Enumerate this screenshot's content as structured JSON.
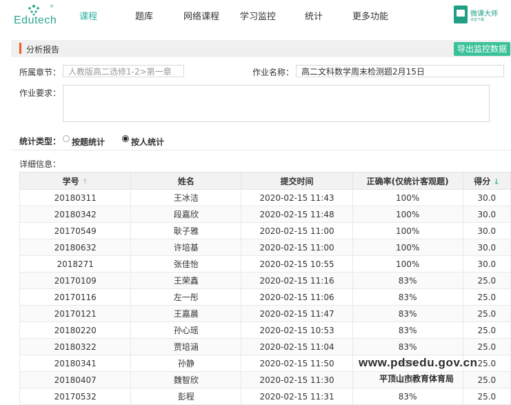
{
  "logo": {
    "text": "Edutech",
    "reg": "®"
  },
  "nav": {
    "items": [
      {
        "label": "课程",
        "active": true
      },
      {
        "label": "题库",
        "active": false
      },
      {
        "label": "网络课程",
        "active": false
      },
      {
        "label": "学习监控",
        "active": false
      },
      {
        "label": "统计",
        "active": false
      },
      {
        "label": "更多功能",
        "active": false
      }
    ]
  },
  "weike": {
    "title": "微课大师",
    "subtitle": "点击下载"
  },
  "section": {
    "title": "分析报告",
    "export_label": "导出监控数据"
  },
  "form": {
    "chapter_label": "所属章节：",
    "chapter_placeholder": "人教版高二选修1-2>第一章",
    "homework_name_label": "作业名称：",
    "homework_name_value": "高二文科数学周末检测题2月15日",
    "requirement_label": "作业要求：",
    "requirement_value": ""
  },
  "stat_type": {
    "label": "统计类型：",
    "options": [
      {
        "label": "按题统计",
        "selected": false
      },
      {
        "label": "按人统计",
        "selected": true
      }
    ]
  },
  "detail_label": "详细信息：",
  "table": {
    "columns": [
      {
        "label": "学号",
        "sort": "↑"
      },
      {
        "label": "姓名",
        "sort": ""
      },
      {
        "label": "提交时间",
        "sort": ""
      },
      {
        "label": "正确率(仅统计客观题)",
        "sort": ""
      },
      {
        "label": "得分",
        "sort": "↓"
      }
    ],
    "rows": [
      [
        "20180311",
        "王冰洁",
        "2020-02-15 11:43",
        "100%",
        "30.0"
      ],
      [
        "20180342",
        "段嘉欣",
        "2020-02-15 11:48",
        "100%",
        "30.0"
      ],
      [
        "20170549",
        "耿子雅",
        "2020-02-15 11:00",
        "100%",
        "30.0"
      ],
      [
        "20180632",
        "许培基",
        "2020-02-15 11:00",
        "100%",
        "30.0"
      ],
      [
        "2018271",
        "张佳怡",
        "2020-02-15 10:55",
        "100%",
        "30.0"
      ],
      [
        "20170109",
        "王荣鑫",
        "2020-02-15 11:16",
        "83%",
        "25.0"
      ],
      [
        "20170116",
        "左一彤",
        "2020-02-15 11:06",
        "83%",
        "25.0"
      ],
      [
        "20170121",
        "王嘉晨",
        "2020-02-15 11:47",
        "83%",
        "25.0"
      ],
      [
        "20180220",
        "孙心瑶",
        "2020-02-15 10:53",
        "83%",
        "25.0"
      ],
      [
        "20180322",
        "贾培涵",
        "2020-02-15 11:04",
        "83%",
        "25.0"
      ],
      [
        "20180341",
        "孙静",
        "2020-02-15 11:50",
        "83%",
        "25.0"
      ],
      [
        "20180407",
        "魏智欣",
        "2020-02-15 11:30",
        "83%",
        "25.0"
      ],
      [
        "20170532",
        "彭程",
        "2020-02-15 11:31",
        "83%",
        "25.0"
      ]
    ]
  },
  "watermark": {
    "url": "www.pdsedu.gov.cn",
    "org": "平顶山市教育体育局"
  },
  "colors": {
    "accent": "#3ac19a",
    "nav_active": "#28b29c",
    "section_mark": "#f15a22"
  }
}
